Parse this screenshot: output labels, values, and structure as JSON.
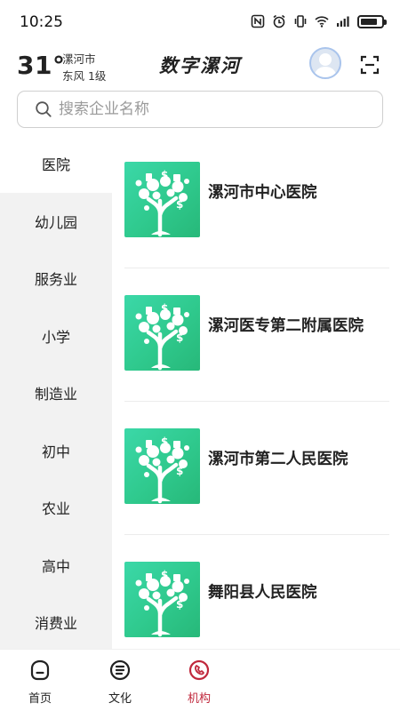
{
  "status_bar": {
    "time": "10:25"
  },
  "header": {
    "temperature": "31°",
    "city": "漯河市",
    "wind": "东风  1级",
    "title": "数字漯河"
  },
  "search": {
    "placeholder": "搜索企业名称",
    "value": ""
  },
  "categories": [
    {
      "label": "医院",
      "active": true
    },
    {
      "label": "幼儿园"
    },
    {
      "label": "服务业"
    },
    {
      "label": "小学"
    },
    {
      "label": "制造业"
    },
    {
      "label": "初中"
    },
    {
      "label": "农业"
    },
    {
      "label": "高中"
    },
    {
      "label": "消费业"
    }
  ],
  "institutions": [
    {
      "name": "漯河市中心医院",
      "icon": "money-tree-icon"
    },
    {
      "name": "漯河医专第二附属医院",
      "icon": "money-tree-icon"
    },
    {
      "name": "漯河市第二人民医院",
      "icon": "money-tree-icon"
    },
    {
      "name": "舞阳县人民医院",
      "icon": "money-tree-icon"
    }
  ],
  "tabs": [
    {
      "label": "首页",
      "icon": "home-icon"
    },
    {
      "label": "文化",
      "icon": "culture-icon"
    },
    {
      "label": "机构",
      "icon": "institution-icon",
      "active": true
    }
  ],
  "colors": {
    "accent": "#c0283c",
    "thumb_green": "#2fc98d",
    "sidebar_bg": "#f2f2f2"
  }
}
